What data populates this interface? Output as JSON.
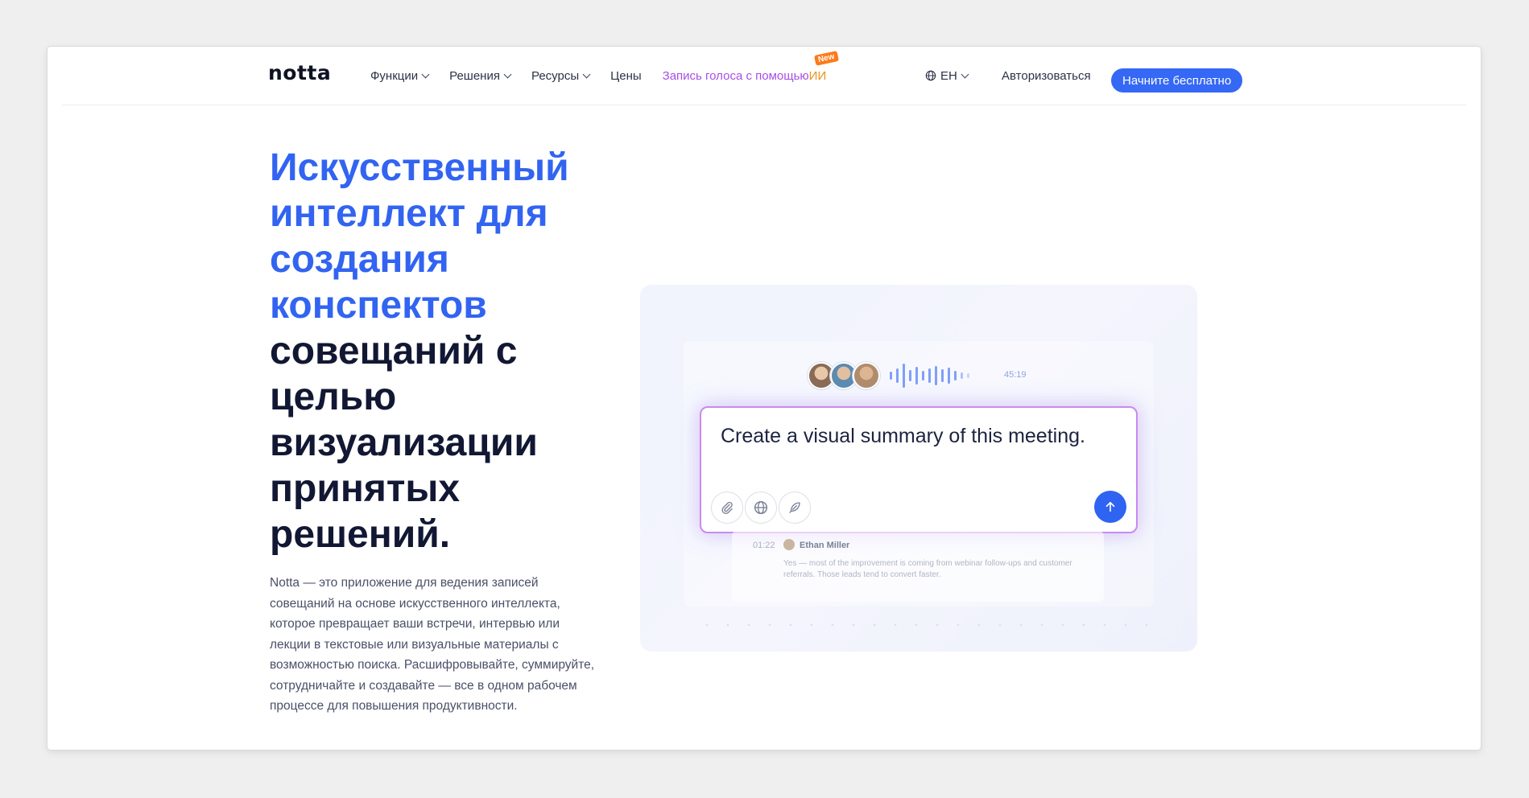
{
  "header": {
    "logo": "notta",
    "nav": [
      {
        "label": "Функции"
      },
      {
        "label": "Решения"
      },
      {
        "label": "Ресурсы"
      },
      {
        "label": "Цены"
      }
    ],
    "promo": {
      "label": "Запись голоса с помощью ",
      "ai": "ИИ",
      "badge": "New"
    },
    "language": "EH",
    "login": "Авторизоваться",
    "cta": "Начните бесплатно"
  },
  "hero": {
    "title_accent_lines": [
      "Искусственный",
      "интеллект для",
      "создания",
      "конспектов"
    ],
    "title_dark_lines": [
      "совещаний с",
      "целью",
      "визуализации",
      "принятых",
      "решений."
    ],
    "description": "Notta — это приложение для ведения записей совещаний на основе искусственного интеллекта, которое превращает ваши встречи, интервью или лекции в текстовые или визуальные материалы с возможностью поиска. Расшифровывайте, суммируйте, сотрудничайте и создавайте — все в одном рабочем процессе для повышения продуктивности."
  },
  "visual": {
    "duration": "45:19",
    "prompt": "Create a visual summary of this meeting.",
    "tools": [
      "paperclip-icon",
      "globe-icon",
      "feather-icon"
    ],
    "transcript": {
      "time": "01:22",
      "speaker": "Ethan Miller",
      "text": "Yes — most of the improvement is coming from webinar follow-ups and customer referrals. Those leads tend to convert faster."
    }
  },
  "colors": {
    "accent": "#3264f1",
    "cta": "#3568f5",
    "promo": "#a64fe8",
    "ai": "#e9931c"
  }
}
